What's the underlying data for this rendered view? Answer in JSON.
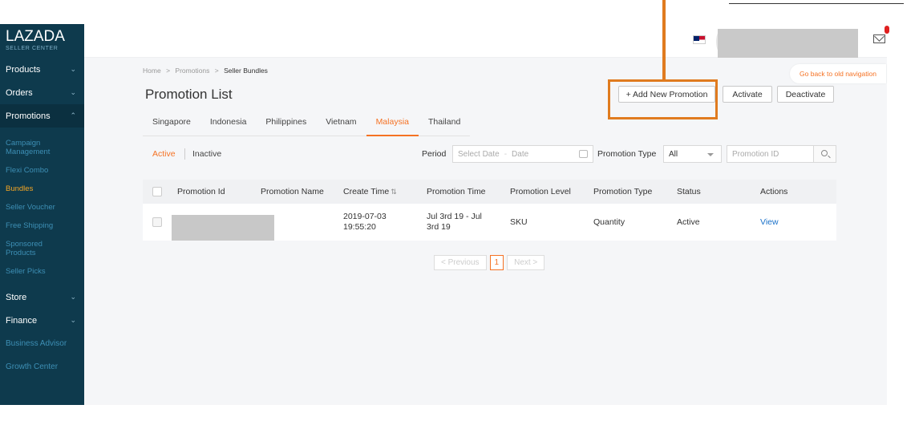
{
  "brand": {
    "name": "LAZADA",
    "sub": "SELLER CENTER"
  },
  "sidebar": {
    "sections": [
      {
        "label": "Products",
        "chevron": "⌄"
      },
      {
        "label": "Orders",
        "chevron": "⌄"
      },
      {
        "label": "Promotions",
        "chevron": "⌃"
      }
    ],
    "promotion_items": [
      {
        "label": "Campaign Management"
      },
      {
        "label": "Flexi Combo"
      },
      {
        "label": "Bundles"
      },
      {
        "label": "Seller Voucher"
      },
      {
        "label": "Free Shipping"
      },
      {
        "label": "Sponsored Products"
      },
      {
        "label": "Seller Picks"
      }
    ],
    "bottom_sections": [
      {
        "label": "Store",
        "chevron": "⌄"
      },
      {
        "label": "Finance",
        "chevron": "⌄"
      }
    ],
    "links": [
      {
        "label": "Business Advisor"
      },
      {
        "label": "Growth Center"
      }
    ]
  },
  "main": {
    "old_nav_label": "Go back to old navigation",
    "breadcrumb": [
      "Home",
      "Promotions",
      "Seller Bundles"
    ],
    "breadcrumb_sep": ">",
    "title": "Promotion List",
    "buttons": {
      "add": "+ Add New Promotion",
      "activate": "Activate",
      "deactivate": "Deactivate"
    },
    "tabs": [
      "Singapore",
      "Indonesia",
      "Philippines",
      "Vietnam",
      "Malaysia",
      "Thailand"
    ],
    "active_tab": "Malaysia",
    "filters": {
      "active": "Active",
      "inactive": "Inactive",
      "period_label": "Period",
      "date_start_placeholder": "Select Date",
      "date_sep": "-",
      "date_end_placeholder": "Date",
      "type_label": "Promotion Type",
      "type_value": "All",
      "pid_placeholder": "Promotion ID"
    },
    "table": {
      "headers": [
        "Promotion Id",
        "Promotion Name",
        "Create Time",
        "Promotion Time",
        "Promotion Level",
        "Promotion Type",
        "Status",
        "Actions"
      ],
      "sort_glyph": "⇅",
      "rows": [
        {
          "id": "",
          "name": "",
          "create_time": "2019-07-03 19:55:20",
          "promo_time": "Jul 3rd 19 - Jul 3rd 19",
          "level": "SKU",
          "type": "Quantity",
          "status": "Active",
          "action": "View"
        }
      ]
    },
    "pager": {
      "prev": "< Previous",
      "current": "1",
      "next": "Next >"
    }
  },
  "colors": {
    "accent": "#f57224",
    "sidebar_bg": "#0e3a4d",
    "link": "#1a71c9",
    "highlight": "#e07b1f"
  }
}
